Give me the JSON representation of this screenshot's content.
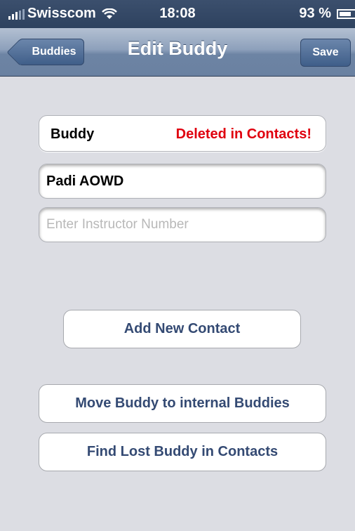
{
  "status_bar": {
    "carrier": "Swisscom",
    "time": "18:08",
    "battery": "93 %",
    "icons": [
      "signal-icon",
      "wifi-icon",
      "battery-icon"
    ]
  },
  "nav": {
    "back_label": "Buddies",
    "title": "Edit Buddy",
    "save_label": "Save"
  },
  "buddy_row": {
    "label": "Buddy",
    "status": "Deleted in Contacts!",
    "status_color": "#e0000f"
  },
  "certification_field": {
    "value": "Padi AOWD"
  },
  "instructor_field": {
    "value": "",
    "placeholder": "Enter Instructor Number"
  },
  "actions": {
    "add_contact": "Add New Contact",
    "move_buddy": "Move Buddy to internal Buddies",
    "find_buddy": "Find Lost Buddy in Contacts"
  },
  "colors": {
    "background": "#dcdde3",
    "button_text": "#344a73",
    "nav_bar": "#6d84a4"
  }
}
